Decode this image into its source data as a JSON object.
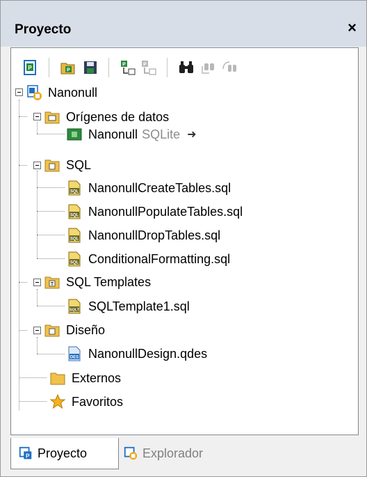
{
  "window": {
    "title": "Proyecto",
    "close_glyph": "×"
  },
  "toolbar": {
    "buttons": [
      {
        "icon": "project-icon"
      },
      {
        "icon": "open-project-icon"
      },
      {
        "icon": "save-project-icon"
      },
      {
        "icon": "add-data-source-icon"
      },
      {
        "icon": "add-file-icon"
      },
      {
        "icon": "find-icon"
      },
      {
        "icon": "find-next-icon"
      },
      {
        "icon": "replace-icon"
      }
    ]
  },
  "tree": {
    "root": "Nanonull",
    "data_sources_folder": "Orígenes de datos",
    "data_source": {
      "name": "Nanonull",
      "type": "SQLite",
      "connect_glyph": "➜"
    },
    "sql_folder": "SQL",
    "sql_files": [
      "NanonullCreateTables.sql",
      "NanonullPopulateTables.sql",
      "NanonullDropTables.sql",
      "ConditionalFormatting.sql"
    ],
    "templates_folder": "SQL Templates",
    "template_files": [
      "SQLTemplate1.sql"
    ],
    "design_folder": "Diseño",
    "design_files": [
      "NanonullDesign.qdes"
    ],
    "external_folder": "Externos",
    "favorites_folder": "Favoritos"
  },
  "tabs": [
    {
      "label": "Proyecto",
      "active": true
    },
    {
      "label": "Explorador",
      "active": false
    }
  ],
  "colors": {
    "titlebar": "#d8dee8",
    "folder": "#f0c24b",
    "accent_blue": "#1e6fc4",
    "green": "#1f8a3a"
  }
}
